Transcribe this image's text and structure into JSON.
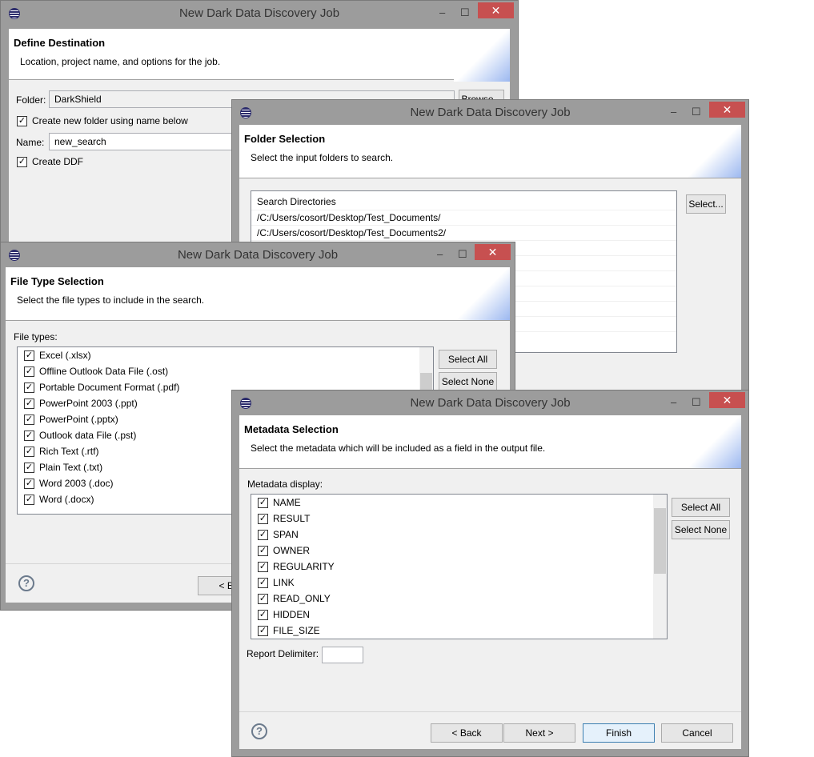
{
  "window_title": "New Dark Data Discovery Job",
  "w1": {
    "title": "Define Destination",
    "desc": "Location, project name, and options for the job.",
    "folder_label": "Folder:",
    "folder_value": "DarkShield",
    "browse": "Browse...",
    "create_folder": "Create new folder using name below",
    "name_label": "Name:",
    "name_value": "new_search",
    "create_ddf": "Create DDF"
  },
  "w2": {
    "title": "Folder Selection",
    "desc": "Select the input folders to search.",
    "column": "Search Directories",
    "rows": [
      "/C:/Users/cosort/Desktop/Test_Documents/",
      "/C:/Users/cosort/Desktop/Test_Documents2/"
    ],
    "select": "Select..."
  },
  "w3": {
    "title": "File Type Selection",
    "desc": "Select the file types to include in the search.",
    "label": "File types:",
    "items": [
      "Excel (.xlsx)",
      "Offline Outlook Data File (.ost)",
      "Portable Document Format (.pdf)",
      "PowerPoint 2003 (.ppt)",
      "PowerPoint (.pptx)",
      "Outlook data File (.pst)",
      "Rich Text (.rtf)",
      "Plain Text (.txt)",
      "Word 2003 (.doc)",
      "Word (.docx)"
    ],
    "select_all": "Select All",
    "select_none": "Select None",
    "back": "< Back"
  },
  "w4": {
    "title": "Metadata Selection",
    "desc": "Select the metadata which will be included as a field in the output file.",
    "label": "Metadata display:",
    "items": [
      "NAME",
      "RESULT",
      "SPAN",
      "OWNER",
      "REGULARITY",
      "LINK",
      "READ_ONLY",
      "HIDDEN",
      "FILE_SIZE"
    ],
    "select_all": "Select All",
    "select_none": "Select None",
    "delimiter_label": "Report Delimiter:",
    "delimiter_value": "",
    "back": "< Back",
    "next": "Next >",
    "finish": "Finish",
    "cancel": "Cancel"
  },
  "icons": {
    "help": "?",
    "check": "✓",
    "close": "✕",
    "minimize": "‒",
    "maximize": "☐"
  }
}
